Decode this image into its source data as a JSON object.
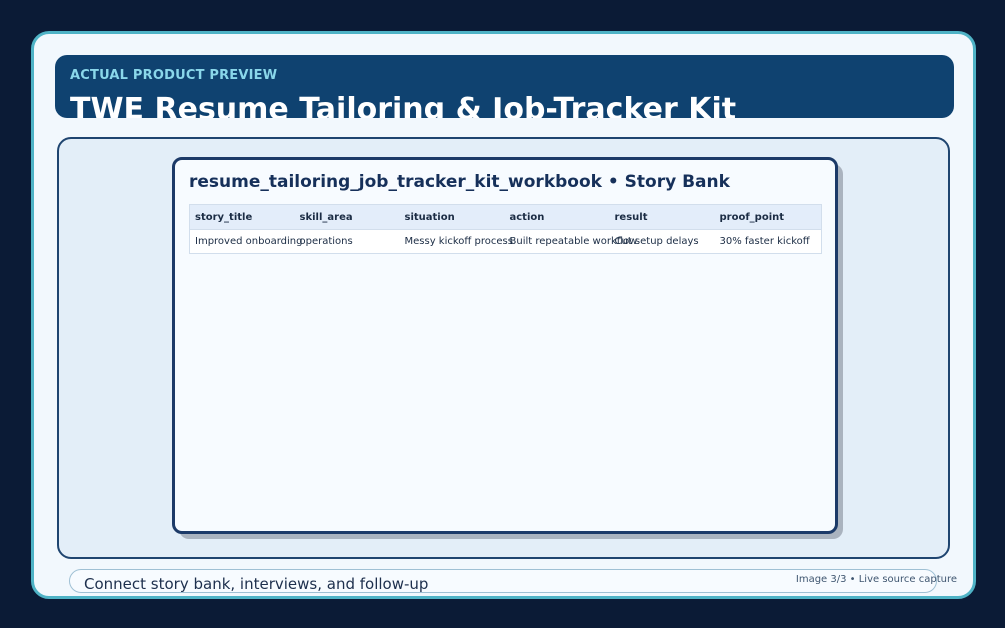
{
  "header": {
    "eyebrow": "ACTUAL PRODUCT PREVIEW",
    "title": "TWE Resume Tailoring & Job-Tracker Kit"
  },
  "sheet": {
    "title": "resume_tailoring_job_tracker_kit_workbook • Story Bank",
    "columns": [
      "story_title",
      "skill_area",
      "situation",
      "action",
      "result",
      "proof_point"
    ],
    "rows": [
      {
        "story_title": "Improved onboarding",
        "skill_area": "operations",
        "situation": "Messy kickoff process",
        "action": "Built repeatable workflow",
        "result": "Cut setup delays",
        "proof_point": "30% faster kickoff"
      }
    ]
  },
  "footer": {
    "caption": "Connect story bank, interviews, and follow-up",
    "counter": "Image 3/3 • Live source capture"
  },
  "colors": {
    "background": "#0b1b36",
    "frame_border": "#4fb3c6",
    "header_bg": "#0f4270",
    "eyebrow": "#8ad7ea",
    "sheet_border": "#1c3a68"
  }
}
